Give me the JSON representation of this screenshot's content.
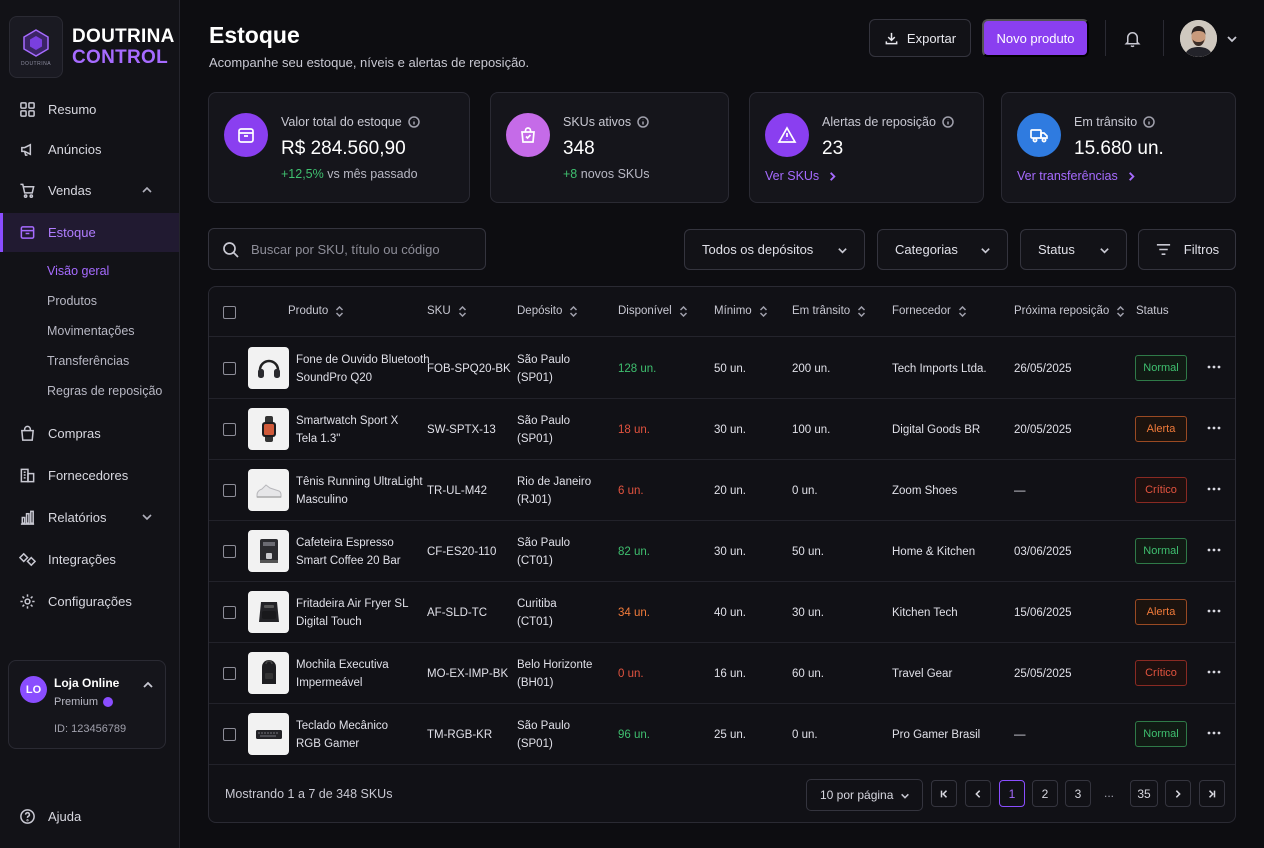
{
  "brand": {
    "line1": "DOUTRINA",
    "line2": "CONTROL",
    "logo_caption": "DOUTRINA"
  },
  "colors": {
    "accent": "#8a3ff0",
    "success": "#3fbf6f",
    "warning": "#f07a3a",
    "danger": "#e2533f"
  },
  "sidebar": {
    "items": [
      {
        "label": "Resumo",
        "icon": "grid-icon"
      },
      {
        "label": "Anúncios",
        "icon": "megaphone-icon"
      },
      {
        "label": "Vendas",
        "icon": "cart-icon"
      },
      {
        "label": "Estoque",
        "icon": "box-icon"
      },
      {
        "label": "Compras",
        "icon": "shopping-bag-icon"
      },
      {
        "label": "Fornecedores",
        "icon": "building-icon"
      },
      {
        "label": "Relatórios",
        "icon": "bar-chart-icon"
      },
      {
        "label": "Integrações",
        "icon": "puzzle-icon"
      },
      {
        "label": "Configurações",
        "icon": "gear-icon"
      }
    ],
    "subitems": [
      "Visão geral",
      "Produtos",
      "Movimentações",
      "Transferências",
      "Regras de reposição"
    ],
    "account": {
      "initials": "LO",
      "name": "Loja Online",
      "plan": "Premium",
      "id": "ID: 123456789"
    },
    "help": "Ajuda"
  },
  "header": {
    "title": "Estoque",
    "subtitle": "Acompanhe seu estoque, níveis e alertas de reposição.",
    "export_label": "Exportar",
    "new_label": "Novo produto"
  },
  "kpis": [
    {
      "label": "Valor total do estoque",
      "value": "R$ 284.560,90",
      "delta_up": "+12,5%",
      "delta_rest": " vs mês passado"
    },
    {
      "label": "SKUs ativos",
      "value": "348",
      "delta_up": "+8",
      "delta_rest": " novos SKUs"
    },
    {
      "label": "Alertas de reposição",
      "value": "23",
      "link": "Ver SKUs"
    },
    {
      "label": "Em trânsito",
      "value": "15.680 un.",
      "link": "Ver transferências"
    }
  ],
  "filters": {
    "search_placeholder": "Buscar por SKU, título ou código",
    "deposits": "Todos os depósitos",
    "categories": "Categorias",
    "status": "Status",
    "filters_label": "Filtros"
  },
  "table": {
    "columns": [
      "Produto",
      "SKU",
      "Depósito",
      "Disponível",
      "Mínimo",
      "Em trânsito",
      "Fornecedor",
      "Próxima reposição",
      "Status"
    ],
    "rows": [
      {
        "name1": "Fone de Ouvido Bluetooth",
        "name2": "SoundPro Q20",
        "sku": "FOB-SPQ20-BK",
        "dep1": "São Paulo",
        "dep2": "(SP01)",
        "available": "128 un.",
        "minimum": "50 un.",
        "transit": "200 un.",
        "supplier": "Tech Imports Ltda.",
        "next": "26/05/2025",
        "status": "Normal",
        "thumb": "headphones-icon"
      },
      {
        "name1": "Smartwatch Sport X",
        "name2": "Tela 1.3\"",
        "sku": "SW-SPTX-13",
        "dep1": "São Paulo",
        "dep2": "(SP01)",
        "available": "18 un.",
        "minimum": "30 un.",
        "transit": "100 un.",
        "supplier": "Digital Goods BR",
        "next": "20/05/2025",
        "status": "Alerta",
        "thumb": "smartwatch-icon"
      },
      {
        "name1": "Tênis Running UltraLight",
        "name2": "Masculino",
        "sku": "TR-UL-M42",
        "dep1": "Rio de Janeiro",
        "dep2": "(RJ01)",
        "available": "6 un.",
        "minimum": "20 un.",
        "transit": "0 un.",
        "supplier": "Zoom Shoes",
        "next": "—",
        "status": "Crítico",
        "thumb": "sneaker-icon"
      },
      {
        "name1": "Cafeteira Espresso",
        "name2": "Smart Coffee 20 Bar",
        "sku": "CF-ES20-110",
        "dep1": "São Paulo",
        "dep2": "(CT01)",
        "available": "82 un.",
        "minimum": "30 un.",
        "transit": "50 un.",
        "supplier": "Home & Kitchen",
        "next": "03/06/2025",
        "status": "Normal",
        "thumb": "coffee-machine-icon"
      },
      {
        "name1": "Fritadeira Air Fryer SL",
        "name2": "Digital Touch",
        "sku": "AF-SLD-TC",
        "dep1": "Curitiba",
        "dep2": "(CT01)",
        "available": "34 un.",
        "minimum": "40 un.",
        "transit": "30 un.",
        "supplier": "Kitchen Tech",
        "next": "15/06/2025",
        "status": "Alerta",
        "thumb": "air-fryer-icon"
      },
      {
        "name1": "Mochila Executiva",
        "name2": "Impermeável",
        "sku": "MO-EX-IMP-BK",
        "dep1": "Belo Horizonte",
        "dep2": "(BH01)",
        "available": "0 un.",
        "minimum": "16 un.",
        "transit": "60 un.",
        "supplier": "Travel Gear",
        "next": "25/05/2025",
        "status": "Crítico",
        "thumb": "backpack-icon"
      },
      {
        "name1": "Teclado Mecânico",
        "name2": "RGB Gamer",
        "sku": "TM-RGB-KR",
        "dep1": "São Paulo",
        "dep2": "(SP01)",
        "available": "96 un.",
        "minimum": "25 un.",
        "transit": "0 un.",
        "supplier": "Pro Gamer Brasil",
        "next": "—",
        "status": "Normal",
        "thumb": "keyboard-icon"
      }
    ],
    "footer": {
      "showing": "Mostrando 1 a 7 de 348 SKUs",
      "per_page": "10 por página",
      "pages": [
        "1",
        "2",
        "3"
      ],
      "ellipsis": "...",
      "last_page": "35"
    }
  }
}
